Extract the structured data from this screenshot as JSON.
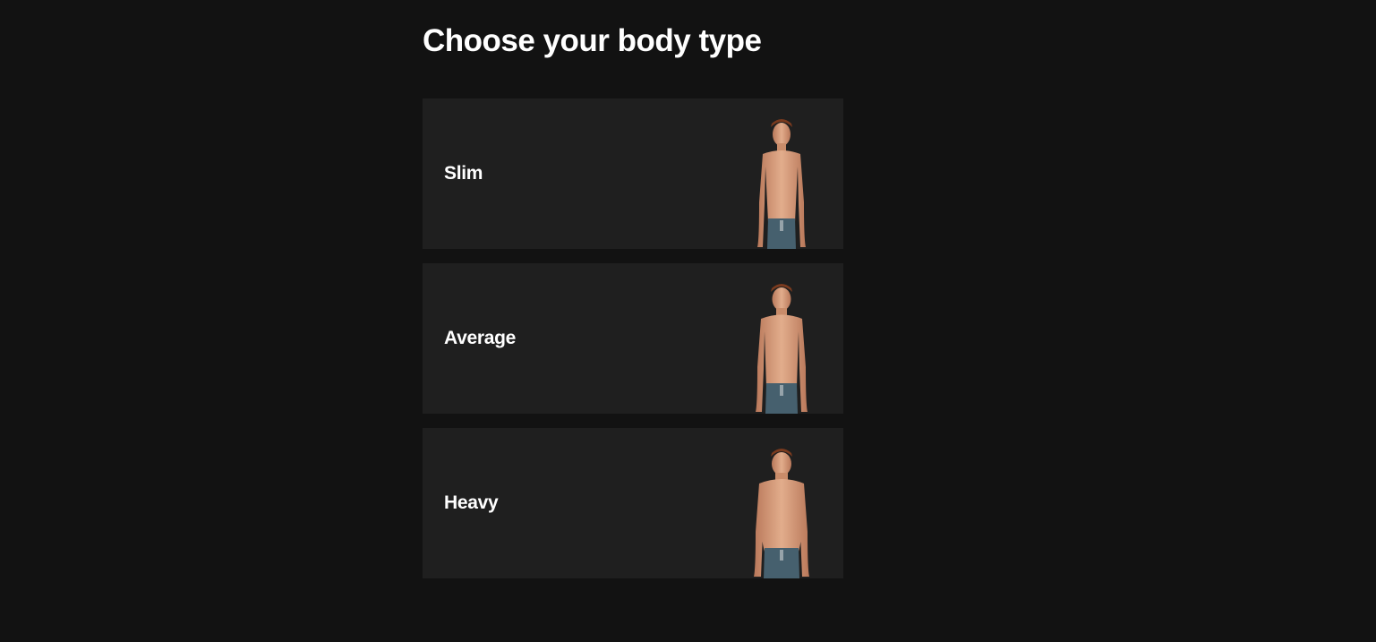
{
  "page": {
    "title": "Choose your body type"
  },
  "options": [
    {
      "label": "Slim",
      "image": "slim-body-figure"
    },
    {
      "label": "Average",
      "image": "average-body-figure"
    },
    {
      "label": "Heavy",
      "image": "heavy-body-figure"
    }
  ],
  "colors": {
    "background": "#121212",
    "card": "#1f1f1f",
    "text": "#ffffff",
    "skin": "#d9a07e",
    "hair": "#7a3a1e",
    "shorts": "#46606e"
  }
}
